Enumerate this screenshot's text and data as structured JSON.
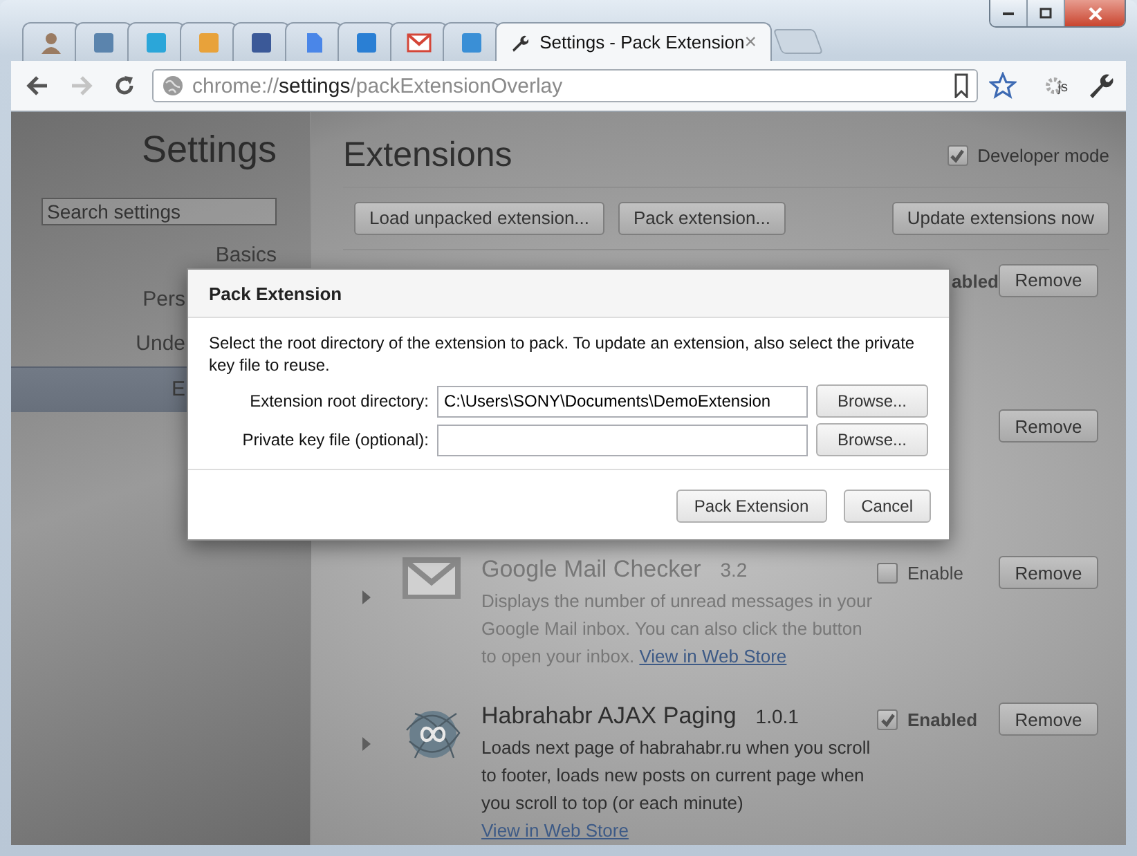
{
  "browser": {
    "tabs": [
      {
        "kind": "person",
        "color": "#9a7b62",
        "selected": false
      },
      {
        "kind": "tile",
        "color": "#5b84ad",
        "selected": false
      },
      {
        "kind": "tile",
        "color": "#2ba6d9",
        "selected": false
      },
      {
        "kind": "tile",
        "color": "#e8a23a",
        "selected": false
      },
      {
        "kind": "tile",
        "color": "#3b5998",
        "selected": false
      },
      {
        "kind": "document",
        "color": "#4a86e8",
        "selected": false
      },
      {
        "kind": "tile",
        "color": "#2a7fd4",
        "selected": false
      },
      {
        "kind": "envelope",
        "color": "#d44638",
        "selected": false
      },
      {
        "kind": "tile",
        "color": "#3a8fd6",
        "selected": false
      },
      {
        "kind": "wrench",
        "color": "#333333",
        "title": "Settings - Pack Extension",
        "close": "×",
        "selected": true
      }
    ],
    "toolbar": {
      "url_scheme": "chrome://",
      "url_host": "settings",
      "url_path": "/packExtensionOverlay",
      "forward_disabled": true,
      "extension_label": "js"
    }
  },
  "sidebar": {
    "title": "Settings",
    "search_placeholder": "Search settings",
    "items": [
      {
        "label": "Basics",
        "kind": "full",
        "selected": false
      },
      {
        "label": "Pers",
        "kind": "cut",
        "selected": false
      },
      {
        "label": "Unde",
        "kind": "cut",
        "selected": false
      },
      {
        "label": "E",
        "kind": "cut",
        "selected": true
      }
    ]
  },
  "extensions": {
    "title": "Extensions",
    "developer_mode": {
      "label": "Developer mode",
      "checked": true
    },
    "buttons": [
      "Load unpacked extension...",
      "Pack extension...",
      "Update extensions now"
    ],
    "rows": [
      {
        "kind": "partial",
        "toggle_label": "abled",
        "enabled": true,
        "remove": "Remove"
      },
      {
        "kind": "partial",
        "remove": "Remove"
      },
      {
        "kind": "full",
        "name": "Google Mail Checker",
        "version": "3.2",
        "description": "Displays the number of unread messages in your Google Mail inbox. You can also click the button to open your inbox.",
        "link": "View in Web Store",
        "enabled": false,
        "toggle_label": "Enable",
        "remove": "Remove"
      },
      {
        "kind": "full",
        "name": "Habrahabr AJAX Paging",
        "version": "1.0.1",
        "description": "Loads next page of habrahabr.ru when you scroll to footer, loads new posts on current page when you scroll to top (or each minute)",
        "link": "View in Web Store",
        "enabled": true,
        "toggle_label": "Enabled",
        "remove": "Remove"
      }
    ]
  },
  "dialog": {
    "title": "Pack Extension",
    "message": "Select the root directory of the extension to pack. To update an extension, also select the private key file to reuse.",
    "fields": [
      {
        "label": "Extension root directory:",
        "value": "C:\\Users\\SONY\\Documents\\DemoExtension",
        "browse": "Browse..."
      },
      {
        "label": "Private key file (optional):",
        "browse": "Browse..."
      }
    ],
    "buttons": [
      "Pack Extension",
      "Cancel"
    ]
  }
}
